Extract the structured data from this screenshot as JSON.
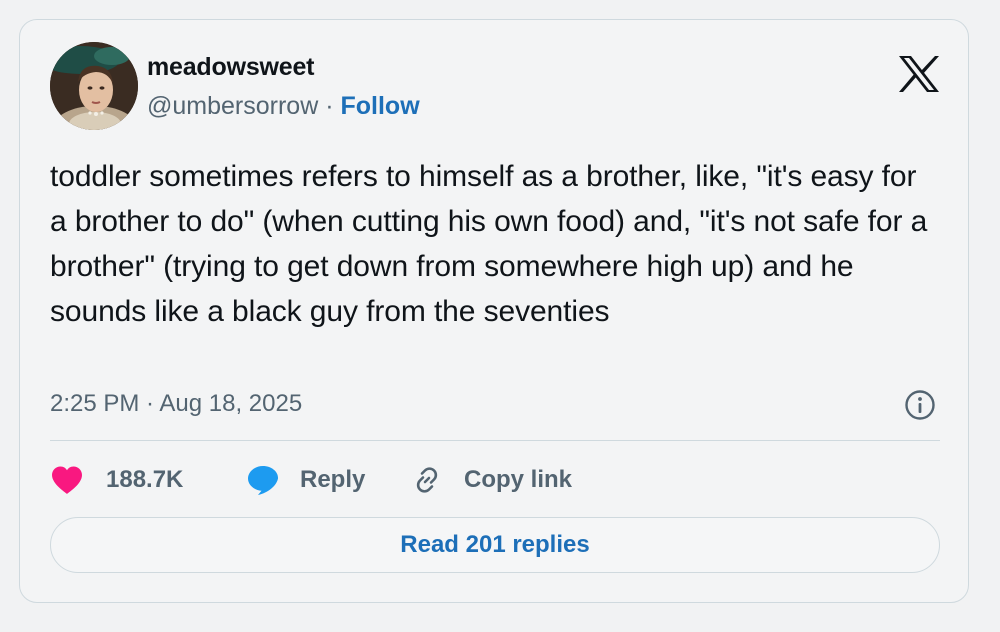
{
  "author": {
    "display_name": "meadowsweet",
    "handle": "@umbersorrow",
    "separator": "·",
    "follow_label": "Follow",
    "avatar_icon": "portrait-avatar"
  },
  "brand": {
    "logo_icon": "x-logo-icon"
  },
  "tweet": {
    "text": "toddler sometimes refers to himself as a brother, like, \"it's easy for a brother to do\" (when cutting his own food) and, \"it's not safe for a brother\" (trying to get down from somewhere high up) and he sounds like a black guy from the seventies",
    "timestamp": "2:25 PM · Aug 18, 2025"
  },
  "actions": {
    "likes": {
      "icon": "heart-icon",
      "count": "188.7K",
      "color": "#f91880"
    },
    "reply": {
      "icon": "speech-bubble-icon",
      "label": "Reply",
      "color": "#1d9bf0"
    },
    "copy_link": {
      "icon": "link-icon",
      "label": "Copy link"
    }
  },
  "footer": {
    "read_replies_label": "Read 201 replies"
  },
  "colors": {
    "text": "#0f1419",
    "secondary": "#536471",
    "link": "#1d6fb8",
    "border": "#cfd9de"
  }
}
